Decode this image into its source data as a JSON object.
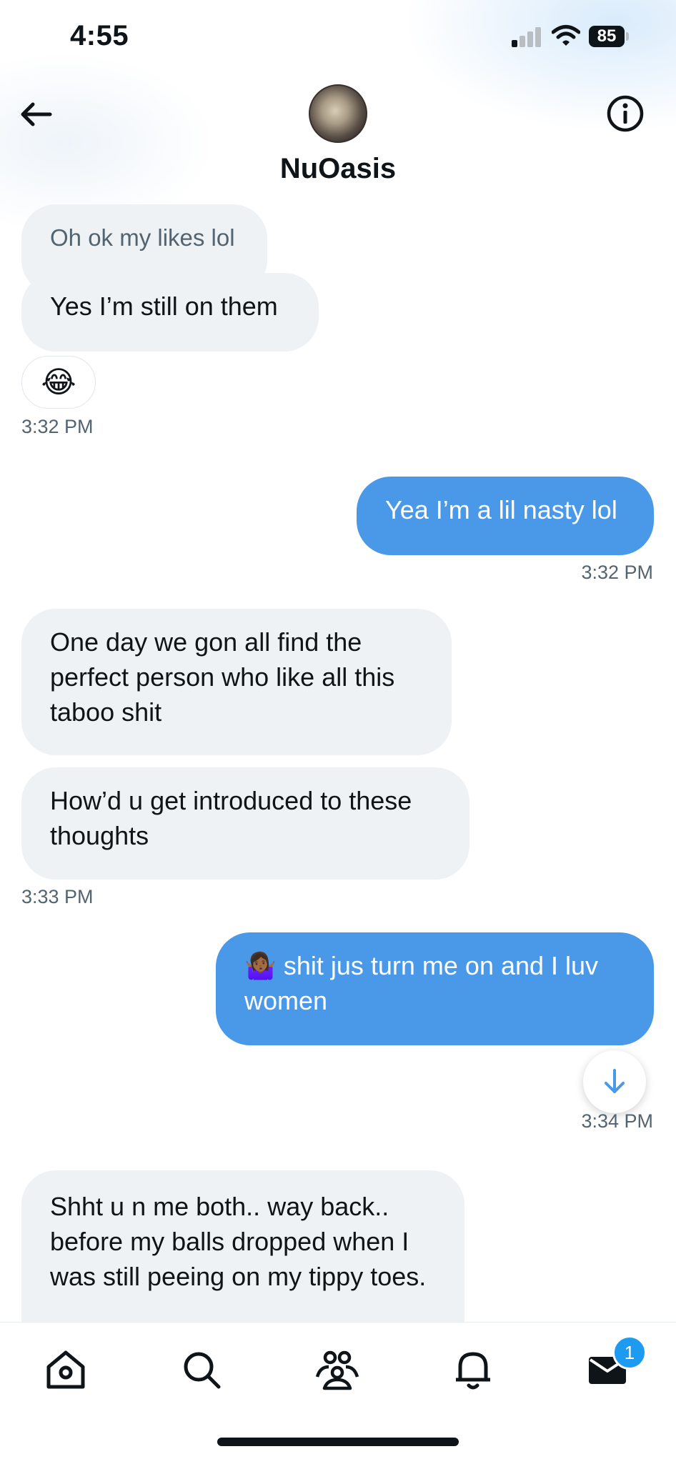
{
  "status_bar": {
    "time": "4:55",
    "battery": "85"
  },
  "header": {
    "name": "NuOasis"
  },
  "messages": [
    {
      "text": "Oh ok my likes lol"
    },
    {
      "text": "Yes I’m still on them"
    },
    {
      "text": "Yea I’m a lil nasty lol"
    },
    {
      "text": "One day we gon all find the perfect person who like all this taboo shit"
    },
    {
      "text": "How’d u get introduced to these thoughts"
    },
    {
      "text": "🤷🏾‍♀️ shit jus turn me on and I luv women"
    },
    {
      "text": "Shht u n me both.. way back.. before my balls dropped when I was still peeing on my tippy toes."
    }
  ],
  "reaction": "😂",
  "timestamps": [
    "3:32 PM",
    "3:32 PM",
    "3:33 PM",
    "3:34 PM"
  ],
  "nav": {
    "items": [
      "home-icon",
      "search-icon",
      "communities-icon",
      "notifications-icon",
      "messages-icon"
    ],
    "messages_badge": "1"
  },
  "colors": {
    "outgoing": "#4a99e9",
    "incoming": "#eff2f4",
    "badge": "#1d9bf0"
  }
}
